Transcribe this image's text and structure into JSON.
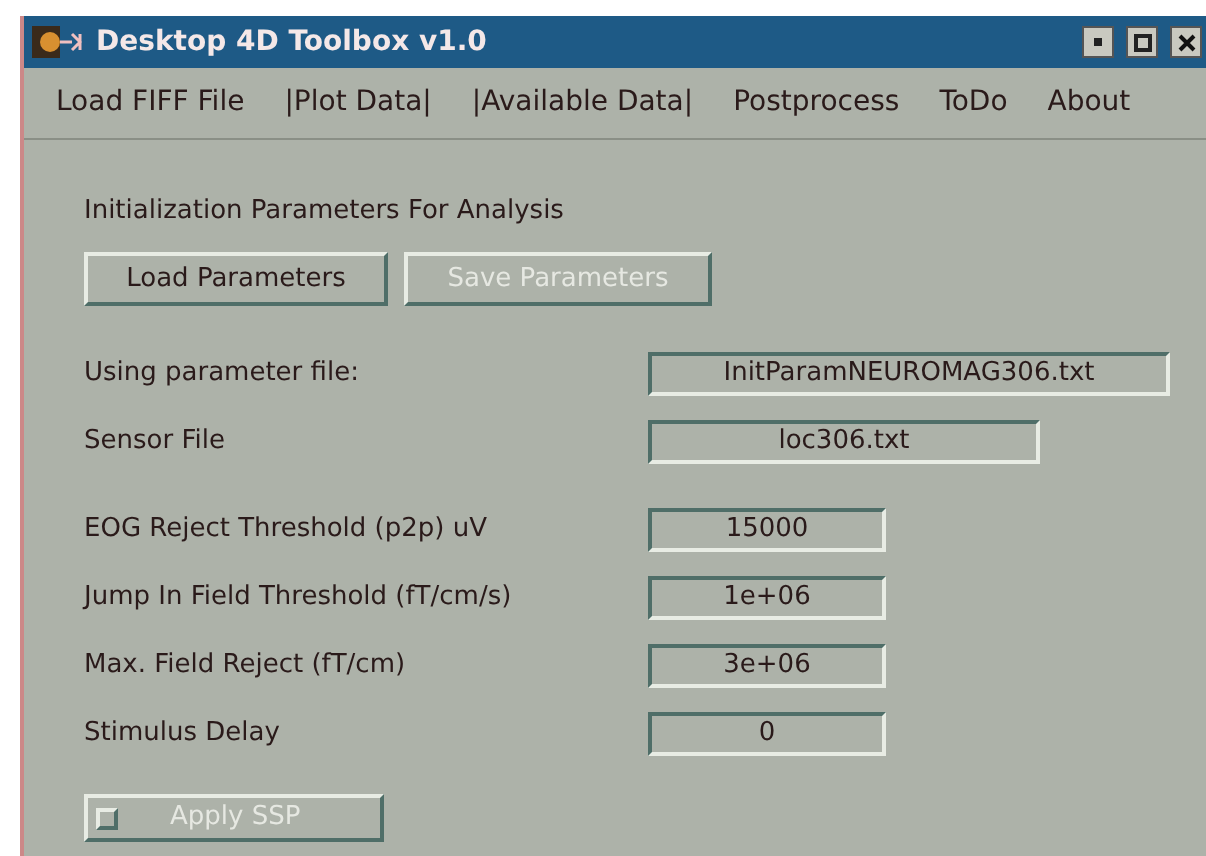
{
  "window": {
    "title": "Desktop 4D Toolbox v1.0"
  },
  "menu": [
    "Load FIFF File",
    "|Plot Data|",
    "|Available Data|",
    "Postprocess",
    "ToDo",
    "About"
  ],
  "heading": "Initialization Parameters For Analysis",
  "buttons": [
    {
      "label": "Load Parameters",
      "disabled": false
    },
    {
      "label": "Save Parameters",
      "disabled": true
    }
  ],
  "fields": [
    {
      "label": "Using parameter file:",
      "value": "InitParamNEUROMAG306.txt"
    },
    {
      "label": "Sensor File",
      "value": "loc306.txt"
    },
    {
      "label": "EOG Reject Threshold (p2p) uV",
      "value": "15000"
    },
    {
      "label": "Jump In Field Threshold (fT/cm/s)",
      "value": "1e+06"
    },
    {
      "label": "Max. Field Reject (fT/cm)",
      "value": "3e+06"
    },
    {
      "label": "Stimulus Delay",
      "value": "0"
    }
  ],
  "toggle": {
    "label": "Apply SSP",
    "checked": false,
    "disabled": true
  }
}
